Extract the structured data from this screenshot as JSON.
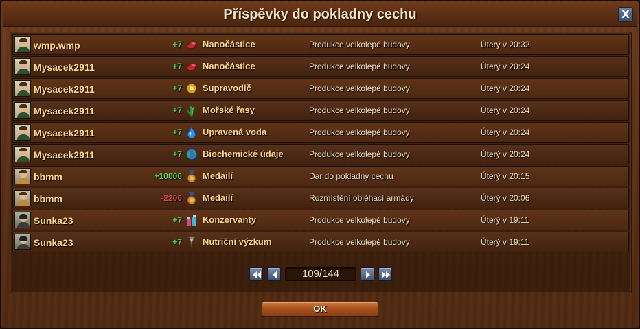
{
  "window": {
    "title": "Příspěvky do pokladny cechu",
    "close_label": "X"
  },
  "colors": {
    "positive": "#5fd14a",
    "negative": "#e04848",
    "player_name": "#ffd88a"
  },
  "rows": [
    {
      "avatar": "player-portrait",
      "player": "wmp.wmp",
      "amount": "+7",
      "good_icon": "nanoparticles-icon",
      "good": "Nanočástice",
      "reason": "Produkce velkolepé budovy",
      "time": "Úterý v 20:32"
    },
    {
      "avatar": "player-portrait",
      "player": "Mysacek2911",
      "amount": "+7",
      "good_icon": "nanoparticles-icon",
      "good": "Nanočástice",
      "reason": "Produkce velkolepé budovy",
      "time": "Úterý v 20:24"
    },
    {
      "avatar": "player-portrait",
      "player": "Mysacek2911",
      "amount": "+7",
      "good_icon": "superconductor-icon",
      "good": "Supravodič",
      "reason": "Produkce velkolepé budovy",
      "time": "Úterý v 20:24"
    },
    {
      "avatar": "player-portrait",
      "player": "Mysacek2911",
      "amount": "+7",
      "good_icon": "seaweed-icon",
      "good": "Mořské řasy",
      "reason": "Produkce velkolepé budovy",
      "time": "Úterý v 20:24"
    },
    {
      "avatar": "player-portrait",
      "player": "Mysacek2911",
      "amount": "+7",
      "good_icon": "water-drop-icon",
      "good": "Upravená voda",
      "reason": "Produkce velkolepé budovy",
      "time": "Úterý v 20:24"
    },
    {
      "avatar": "player-portrait",
      "player": "Mysacek2911",
      "amount": "+7",
      "good_icon": "globe-icon",
      "good": "Biochemické údaje",
      "reason": "Produkce velkolepé budovy",
      "time": "Úterý v 20:24"
    },
    {
      "avatar": "player-portrait",
      "player": "bbmm",
      "amount": "+10000",
      "good_icon": "medal-icon",
      "good": "Medailí",
      "reason": "Dar do pokladny cechu",
      "time": "Úterý v 20:15"
    },
    {
      "avatar": "player-portrait",
      "player": "bbmm",
      "amount": "-2200",
      "good_icon": "medal-icon",
      "good": "Medailí",
      "reason": "Rozmístění obléhací armády",
      "time": "Úterý v 20:06"
    },
    {
      "avatar": "player-portrait",
      "player": "Sunka23",
      "amount": "+7",
      "good_icon": "preservatives-icon",
      "good": "Konzervanty",
      "reason": "Produkce velkolepé budovy",
      "time": "Úterý v 19:11"
    },
    {
      "avatar": "player-portrait",
      "player": "Sunka23",
      "amount": "+7",
      "good_icon": "nutrition-research-icon",
      "good": "Nutriční výzkum",
      "reason": "Produkce velkolepé budovy",
      "time": "Úterý v 19:11"
    }
  ],
  "pagination": {
    "page_text": "109/144",
    "current": 109,
    "total": 144
  },
  "footer": {
    "ok_label": "OK"
  }
}
